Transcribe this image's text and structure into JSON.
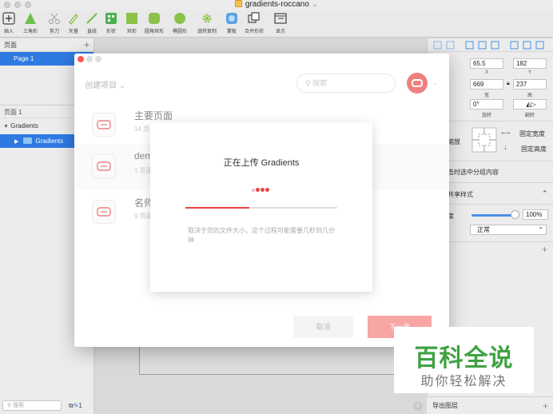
{
  "window": {
    "title": "gradients-roccano"
  },
  "toolbar": {
    "items": [
      {
        "label": "插入"
      },
      {
        "label": "三角形"
      },
      {
        "label": "剪刀"
      },
      {
        "label": "矢量"
      },
      {
        "label": "直线"
      },
      {
        "label": "形状"
      },
      {
        "label": "矩形"
      },
      {
        "label": "圆角矩形"
      },
      {
        "label": "椭圆形"
      },
      {
        "label": "旋转复制"
      },
      {
        "label": "蒙板"
      },
      {
        "label": "合并形状"
      },
      {
        "label": "显示"
      }
    ]
  },
  "left_panel": {
    "header": "页面",
    "plus": "+",
    "page": "Page 1",
    "pages_separator": "页面 1",
    "layer_group": "Gradients",
    "layer_child": "Gradients",
    "search_placeholder": "搜索",
    "layer_count": "1"
  },
  "inspector": {
    "x": "65.5",
    "y": "182",
    "x_label": "X",
    "y_label": "Y",
    "w": "669",
    "h": "237",
    "w_label": "宽",
    "h_label": "高",
    "rotation": "0°",
    "rotation_label": "旋转",
    "flip_label": "翻转",
    "resize_label": "缩放",
    "fixed_width": "固定宽度",
    "fixed_height": "固定高度",
    "click_select": "击时选中分组内容",
    "shared_style": "共享样式",
    "opacity_label": "度",
    "opacity_value": "100%",
    "opacity_fraction": 1,
    "blend_mode": "正常",
    "export_label": "导出图层"
  },
  "dialog": {
    "project_select": "创建项目",
    "search_placeholder": "搜索",
    "rows": [
      {
        "title": "主要页面",
        "sub": "14 页"
      },
      {
        "title": "dem",
        "sub": "1 页面"
      },
      {
        "title": "名师",
        "sub": "9 页面"
      }
    ],
    "cancel": "取消",
    "next": "下一步"
  },
  "upload": {
    "title": "正在上传 Gradients",
    "progress": 0.42,
    "note": "取决于您的文件大小，这个过程可能需要几秒到几分钟"
  },
  "watermark": {
    "main": "百科全说",
    "sub": "助你轻松解决"
  },
  "colors": {
    "accent": "#e84545",
    "selection": "#2f7ae2",
    "watermark": "#3fa243"
  }
}
